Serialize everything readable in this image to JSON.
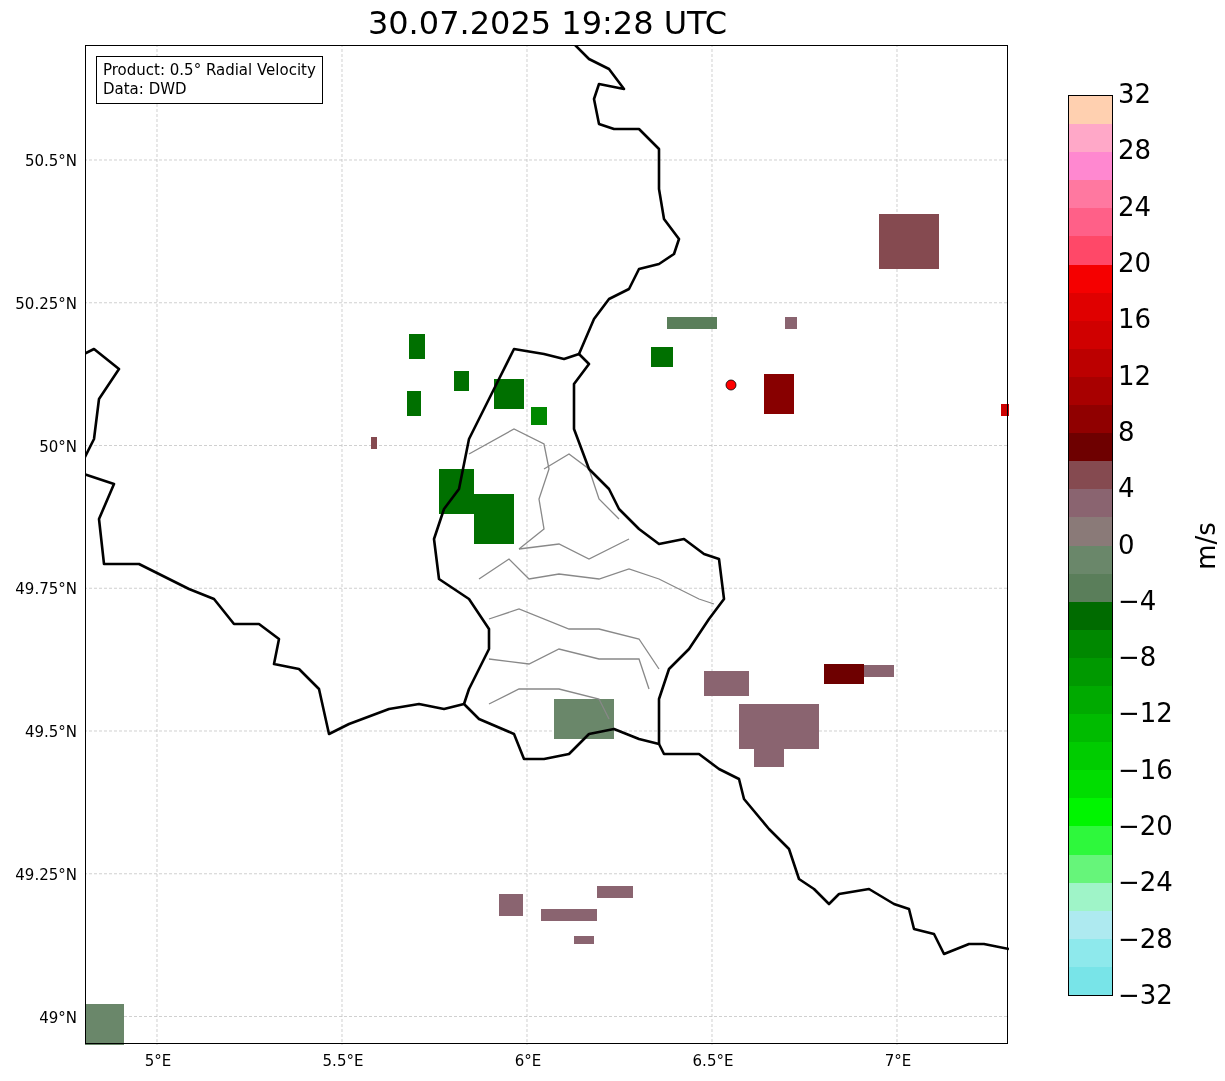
{
  "title": "30.07.2025 19:28 UTC",
  "legend": {
    "lines": [
      "Product: 0.5° Radial Velocity",
      "Data: DWD"
    ]
  },
  "map": {
    "x_ticks": [
      "5°E",
      "5.5°E",
      "6°E",
      "6.5°E",
      "7°E"
    ],
    "y_ticks": [
      "50.5°N",
      "50.25°N",
      "50°N",
      "49.75°N",
      "49.5°N",
      "49.25°N",
      "49°N"
    ]
  },
  "colorbar": {
    "label": "m/s",
    "ticks": [
      "32",
      "28",
      "24",
      "20",
      "16",
      "12",
      "8",
      "4",
      "0",
      "−4",
      "−8",
      "−12",
      "−16",
      "−20",
      "−24",
      "−28",
      "−32"
    ],
    "bands": [
      {
        "color": "#ffd0b0"
      },
      {
        "color": "#ffa8c8"
      },
      {
        "color": "#ff88d0"
      },
      {
        "color": "#ff78a0"
      },
      {
        "color": "#ff6088"
      },
      {
        "color": "#ff4868"
      },
      {
        "color": "#f50000"
      },
      {
        "color": "#e00000"
      },
      {
        "color": "#d00000"
      },
      {
        "color": "#bc0000"
      },
      {
        "color": "#a80000"
      },
      {
        "color": "#900000"
      },
      {
        "color": "#6e0000"
      },
      {
        "color": "#854a50"
      },
      {
        "color": "#8a6470"
      },
      {
        "color": "#8a7a78"
      },
      {
        "color": "#6a876a"
      },
      {
        "color": "#5a7e5a"
      },
      {
        "color": "#006b00"
      },
      {
        "color": "#008800"
      },
      {
        "color": "#009900"
      },
      {
        "color": "#00aa00"
      },
      {
        "color": "#00bb00"
      },
      {
        "color": "#00cc00"
      },
      {
        "color": "#00dd00"
      },
      {
        "color": "#00f500"
      },
      {
        "color": "#2ef83c"
      },
      {
        "color": "#66f57a"
      },
      {
        "color": "#9ff4c8"
      },
      {
        "color": "#aeeaf0"
      },
      {
        "color": "#8ee9ec"
      },
      {
        "color": "#78e4e8"
      }
    ]
  }
}
